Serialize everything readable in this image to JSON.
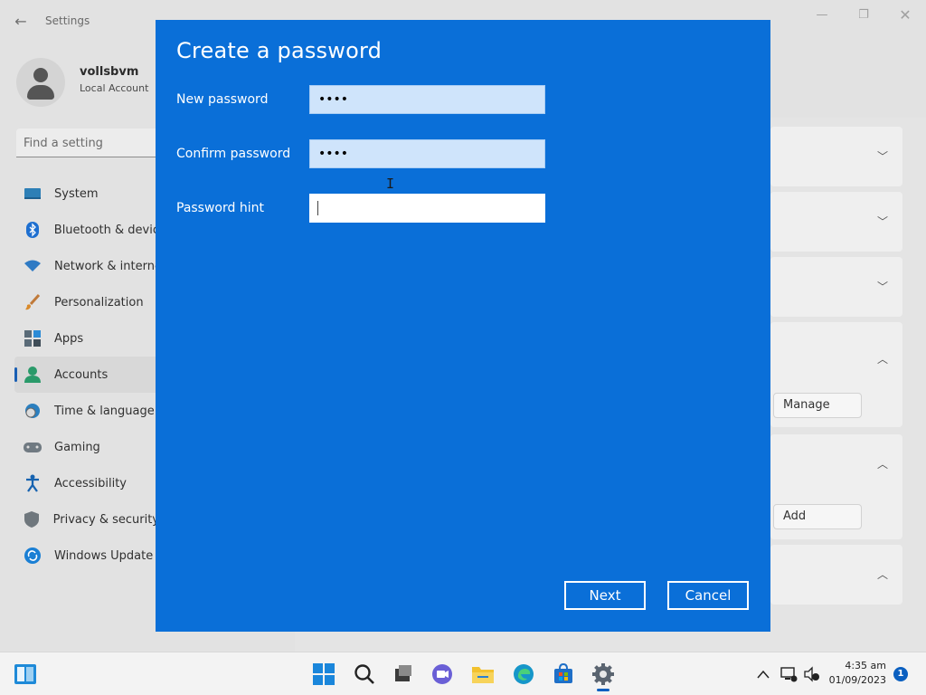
{
  "window": {
    "title": "Settings",
    "back_icon": "back-arrow-icon"
  },
  "profile": {
    "name": "vollsbvm",
    "account_type": "Local Account"
  },
  "search": {
    "placeholder": "Find a setting"
  },
  "sidebar": {
    "items": [
      {
        "label": "System",
        "icon": "system-icon"
      },
      {
        "label": "Bluetooth & devic",
        "icon": "bluetooth-icon"
      },
      {
        "label": "Network & interne",
        "icon": "network-icon"
      },
      {
        "label": "Personalization",
        "icon": "brush-icon"
      },
      {
        "label": "Apps",
        "icon": "apps-icon"
      },
      {
        "label": "Accounts",
        "icon": "accounts-icon",
        "selected": true
      },
      {
        "label": "Time & language",
        "icon": "time-language-icon"
      },
      {
        "label": "Gaming",
        "icon": "gaming-icon"
      },
      {
        "label": "Accessibility",
        "icon": "accessibility-icon"
      },
      {
        "label": "Privacy & security",
        "icon": "shield-icon"
      },
      {
        "label": "Windows Update",
        "icon": "windows-update-icon"
      }
    ]
  },
  "content": {
    "manage_button": "Manage",
    "add_button": "Add"
  },
  "dialog": {
    "title": "Create a password",
    "new_password_label": "New password",
    "new_password_value": "••••",
    "confirm_password_label": "Confirm password",
    "confirm_password_value": "••••",
    "hint_label": "Password hint",
    "hint_value": "",
    "next_button": "Next",
    "cancel_button": "Cancel"
  },
  "taskbar": {
    "time": "4:35 am",
    "date": "01/09/2023",
    "notification_count": "1"
  },
  "colors": {
    "dialog_background": "#0a6fd8",
    "accent": "#0a5fc0"
  }
}
